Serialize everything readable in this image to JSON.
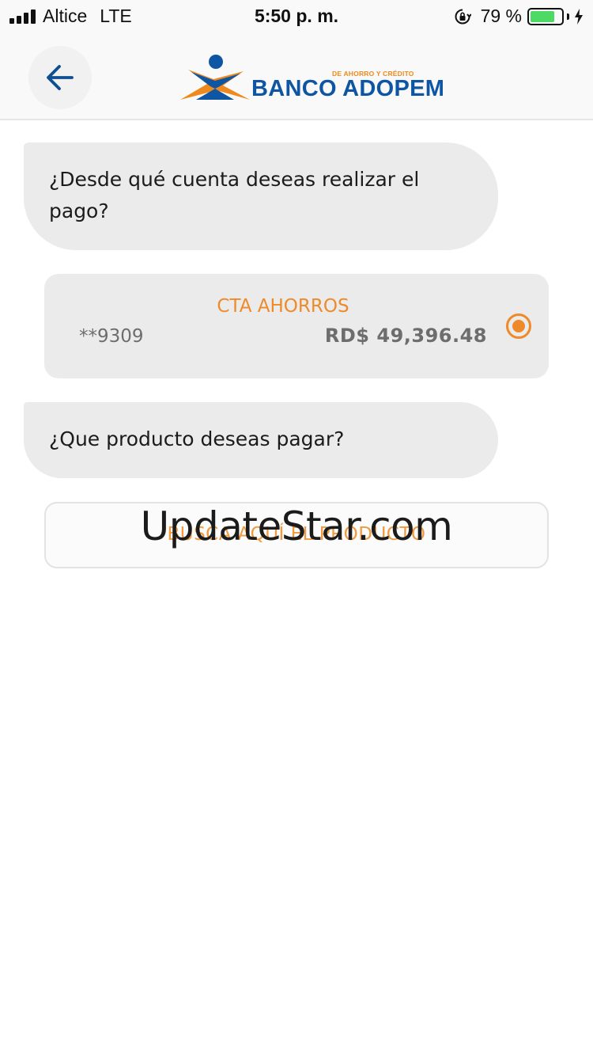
{
  "status_bar": {
    "carrier": "Altice",
    "network": "LTE",
    "time": "5:50 p. m.",
    "battery_percent": "79 %",
    "battery_level": 0.79,
    "icons": [
      "signal-bars-icon",
      "orientation-lock-icon",
      "battery-icon",
      "charging-bolt-icon"
    ]
  },
  "header": {
    "back_icon": "arrow-left-icon",
    "logo": {
      "tagline": "DE AHORRO Y CRÉDITO",
      "name": "BANCO ADOPEM"
    },
    "colors": {
      "brand_blue": "#0e56a3",
      "brand_orange": "#ee8a1d"
    }
  },
  "chat": {
    "question_account": "¿Desde qué cuenta deseas realizar el pago?",
    "question_product": "¿Que producto deseas pagar?"
  },
  "account": {
    "type": "CTA AHORROS",
    "number": "**9309",
    "balance": "RD$ 49,396.48",
    "selected": true,
    "accent_color": "#ee8a2a"
  },
  "product_search": {
    "placeholder": "BUSCA AQUÍ EL PRODUCTO"
  },
  "watermark": "UpdateStar.com"
}
